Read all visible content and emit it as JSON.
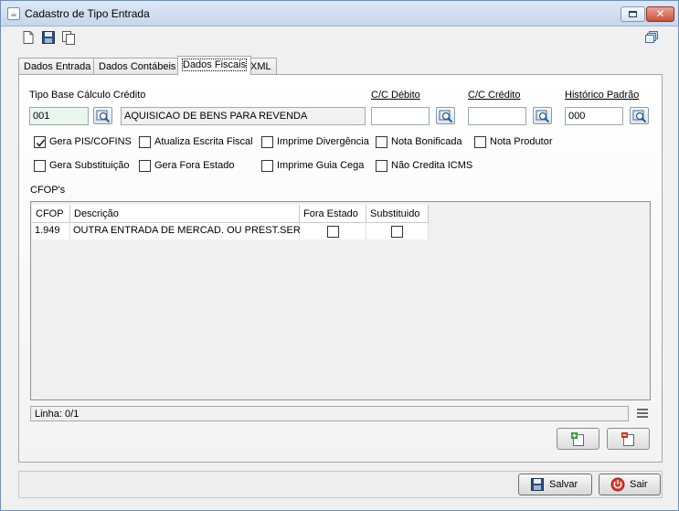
{
  "window": {
    "title": "Cadastro de Tipo Entrada"
  },
  "tabs": [
    {
      "label": "Dados Entrada",
      "active": false
    },
    {
      "label": "Dados Contábeis",
      "active": false
    },
    {
      "label": "Dados Fiscais",
      "active": true
    },
    {
      "label": "XML",
      "active": false
    }
  ],
  "fiscal": {
    "tipo_base_label": "Tipo Base Cálculo Crédito",
    "tipo_base_code": "001",
    "tipo_base_desc": "AQUISICAO DE BENS PARA REVENDA",
    "cc_debito_label": "C/C Débito",
    "cc_debito_value": "",
    "cc_credito_label": "C/C Crédito",
    "cc_credito_value": "",
    "historico_label": "Histórico Padrão",
    "historico_value": "000"
  },
  "checkboxes": [
    {
      "label": "Gera PIS/COFINS",
      "checked": true
    },
    {
      "label": "Atualiza Escrita Fiscal",
      "checked": false
    },
    {
      "label": "Imprime Divergência",
      "checked": false
    },
    {
      "label": "Nota Bonificada",
      "checked": false
    },
    {
      "label": "Nota Produtor",
      "checked": false
    },
    {
      "label": "Gera Substituição",
      "checked": false
    },
    {
      "label": "Gera Fora Estado",
      "checked": false
    },
    {
      "label": "Imprime Guia Cega",
      "checked": false
    },
    {
      "label": "Não Credita ICMS",
      "checked": false
    }
  ],
  "cfops": {
    "label": "CFOP's",
    "columns": [
      "CFOP",
      "Descrição",
      "Fora Estado",
      "Substituido"
    ],
    "rows": [
      {
        "cfop": "1.949",
        "descricao": "OUTRA ENTRADA DE MERCAD. OU PREST.SERV.",
        "fora_estado": false,
        "substituido": false
      }
    ],
    "status": "Linha: 0/1"
  },
  "footer": {
    "save_label": "Salvar",
    "exit_label": "Sair"
  },
  "colors": {
    "accent": "#0067c0",
    "close_red": "#c9503a",
    "field_green": "#e9f7ee"
  },
  "icons": {
    "toolbar": [
      "new-document-icon",
      "save-disk-icon",
      "copy-icon"
    ],
    "window_right": "stacked-windows-icon"
  }
}
